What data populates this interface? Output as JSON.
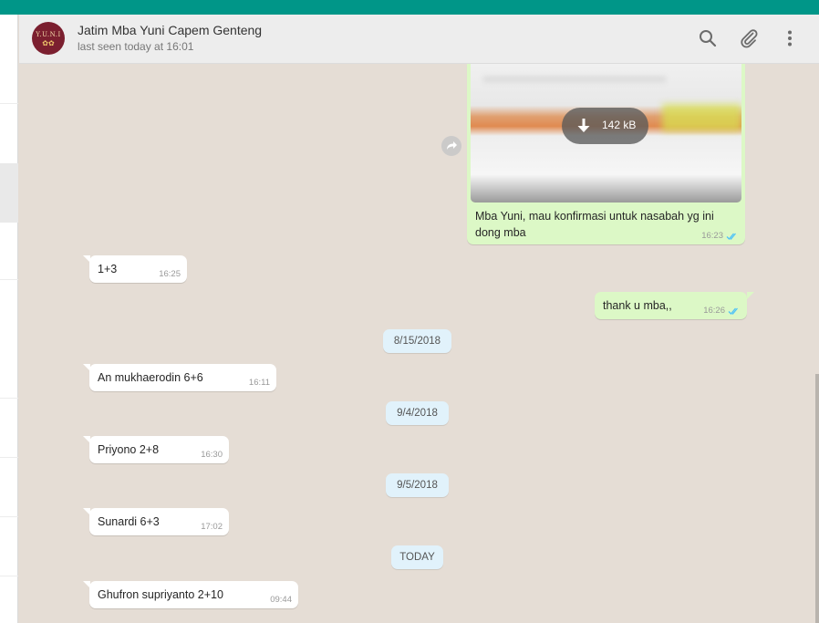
{
  "header": {
    "contact_name": "Jatim Mba Yuni Capem Genteng",
    "last_seen": "last seen today at 16:01",
    "avatar_text": "Y.U.N.I",
    "avatar_mark": "✿✿"
  },
  "image_message": {
    "download_size": "142 kB",
    "caption": "Mba Yuni, mau konfirmasi untuk nasabah yg ini dong mba",
    "time": "16:23"
  },
  "messages": [
    {
      "dir": "in",
      "text": "1+3",
      "time": "16:25"
    },
    {
      "dir": "out",
      "text": "thank u mba,,",
      "time": "16:26"
    },
    {
      "dir": "date",
      "text": "8/15/2018"
    },
    {
      "dir": "in",
      "text": "An mukhaerodin 6+6",
      "time": "16:11"
    },
    {
      "dir": "date",
      "text": "9/4/2018"
    },
    {
      "dir": "in",
      "text": "Priyono 2+8",
      "time": "16:30"
    },
    {
      "dir": "date",
      "text": "9/5/2018"
    },
    {
      "dir": "in",
      "text": "Sunardi 6+3",
      "time": "17:02"
    },
    {
      "dir": "date",
      "text": "TODAY"
    },
    {
      "dir": "in",
      "text": "Ghufron supriyanto 2+10",
      "time": "09:44"
    }
  ],
  "icons": [
    "search-icon",
    "attach-icon",
    "menu-icon",
    "download-icon",
    "forward-icon",
    "double-check-icon"
  ],
  "colors": {
    "accent": "#009688",
    "bubble_out": "#dcf8c6",
    "bubble_in": "#ffffff",
    "date_pill": "#e1f2fb",
    "read_ticks": "#4fc3f7"
  }
}
